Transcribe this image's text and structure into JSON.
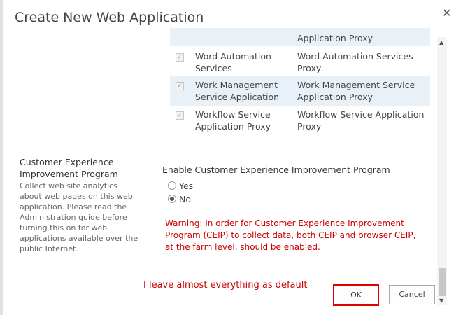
{
  "dialog": {
    "title": "Create New Web Application",
    "close_glyph": "✕"
  },
  "services": [
    {
      "checked": true,
      "name": "",
      "proxy": "Application Proxy",
      "highlight": true
    },
    {
      "checked": true,
      "name": "Word Automation Services",
      "proxy": "Word Automation Services Proxy",
      "highlight": false
    },
    {
      "checked": true,
      "name": "Work Management Service Application",
      "proxy": "Work Management Service Application Proxy",
      "highlight": true
    },
    {
      "checked": true,
      "name": "Workflow Service Application Proxy",
      "proxy": "Workflow Service Application Proxy",
      "highlight": false
    }
  ],
  "ceip": {
    "section_title": "Customer Experience Improvement Program",
    "section_description": "Collect web site analytics about web pages on this web application. Please read the Administration guide before turning this on for web applications available over the public Internet.",
    "field_label": "Enable Customer Experience Improvement Program",
    "options": [
      {
        "label": "Yes",
        "selected": false
      },
      {
        "label": "No",
        "selected": true
      }
    ],
    "warning": "Warning: In order for Customer Experience Improvement Program (CEIP) to collect data, both CEIP and browser CEIP, at the farm level, should be enabled."
  },
  "annotation": "I leave almost everything as default",
  "buttons": {
    "ok": "OK",
    "cancel": "Cancel"
  },
  "colors": {
    "warning": "#cc0000",
    "highlight_row": "#e9f1f8",
    "ok_outline": "#e00000"
  }
}
